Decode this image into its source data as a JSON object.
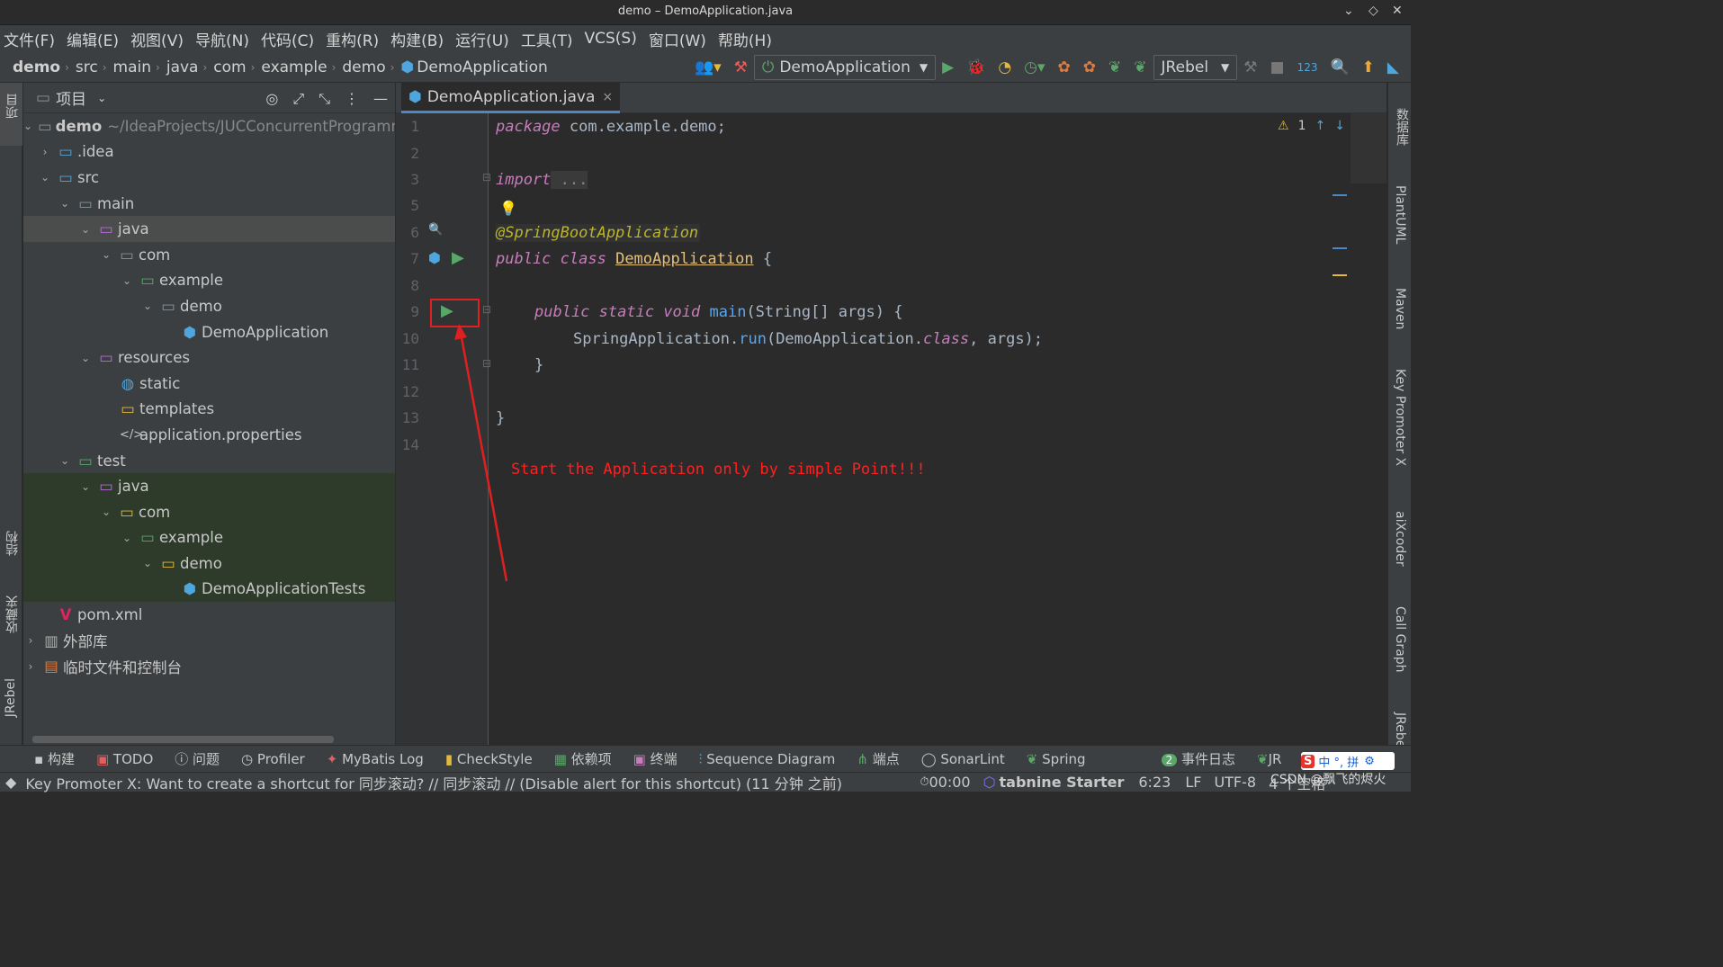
{
  "window": {
    "title": "demo – DemoApplication.java"
  },
  "menu": [
    "文件(F)",
    "编辑(E)",
    "视图(V)",
    "导航(N)",
    "代码(C)",
    "重构(R)",
    "构建(B)",
    "运行(U)",
    "工具(T)",
    "VCS(S)",
    "窗口(W)",
    "帮助(H)"
  ],
  "breadcrumbs": [
    "demo",
    "src",
    "main",
    "java",
    "com",
    "example",
    "demo",
    "DemoApplication"
  ],
  "toolbar": {
    "run_config": "DemoApplication",
    "jrebel": "JRebel",
    "counter": "123"
  },
  "left_strip": {
    "project": "项目",
    "structure": "结构",
    "favorites": "收藏夹",
    "jrebel": "JRebel"
  },
  "project_panel": {
    "title": "项目"
  },
  "tree": [
    {
      "label": "demo",
      "path": "~/IdeaProjects/JUCConcurrentProgramm"
    },
    {
      "label": ".idea"
    },
    {
      "label": "src"
    },
    {
      "label": "main"
    },
    {
      "label": "java"
    },
    {
      "label": "com"
    },
    {
      "label": "example"
    },
    {
      "label": "demo"
    },
    {
      "label": "DemoApplication"
    },
    {
      "label": "resources"
    },
    {
      "label": "static"
    },
    {
      "label": "templates"
    },
    {
      "label": "application.properties"
    },
    {
      "label": "test"
    },
    {
      "label": "java"
    },
    {
      "label": "com"
    },
    {
      "label": "example"
    },
    {
      "label": "demo"
    },
    {
      "label": "DemoApplicationTests"
    },
    {
      "label": "pom.xml"
    },
    {
      "label": "外部库"
    },
    {
      "label": "临时文件和控制台"
    }
  ],
  "editor": {
    "tab": "DemoApplication.java",
    "warnings": "1",
    "line_numbers": [
      "1",
      "2",
      "3",
      "5",
      "6",
      "7",
      "8",
      "9",
      "10",
      "11",
      "12",
      "13",
      "14"
    ],
    "code": {
      "l1_kw": "package",
      "l1_rest": " com.example.demo;",
      "l3_kw": "import",
      "l3_rest": " ...",
      "l6": "@SpringBootApplication",
      "l7_kw": "public class",
      "l7_cls": "DemoApplication",
      "l7_rest": " {",
      "l9_kw": "public static void",
      "l9_fn": "main",
      "l9_rest": "(String[] args) {",
      "l10_a": "SpringApplication.",
      "l10_fn": "run",
      "l10_b": "(DemoApplication.",
      "l10_kw": "class",
      "l10_c": ", args);",
      "l11": "}",
      "l13": "}"
    },
    "annotation": "Start the Application only by simple Point!!!"
  },
  "right_strip": [
    "数据库",
    "PlantUML",
    "Maven",
    "Key Promoter X",
    "aiXcoder",
    "Call Graph",
    "JRebel"
  ],
  "bottom_tools": [
    "构建",
    "TODO",
    "问题",
    "Profiler",
    "MyBatis Log",
    "CheckStyle",
    "依赖项",
    "终端",
    "Sequence Diagram",
    "端点",
    "SonarLint",
    "Spring",
    "事件日志",
    "JR"
  ],
  "bottom_badge": "2",
  "status": {
    "message": "Key Promoter X: Want to create a shortcut for 同步滚动? // 同步滚动 // (Disable alert for this shortcut) (11 分钟 之前)",
    "timer": "00:00",
    "tabnine": "tabnine Starter",
    "position": "6:23",
    "line_sep": "LF",
    "encoding": "UTF-8",
    "indent": "4 个空格",
    "watermark": "CSDN @飘飞的烬火",
    "ime": "中 °, 拼"
  }
}
